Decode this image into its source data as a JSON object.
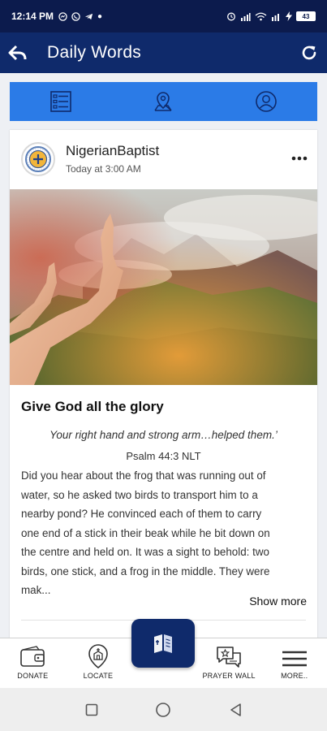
{
  "status_bar": {
    "time": "12:14 PM",
    "battery": "43"
  },
  "app_bar": {
    "title": "Daily Words"
  },
  "tabs": [
    {
      "icon": "list-icon"
    },
    {
      "icon": "location-pin-icon"
    },
    {
      "icon": "user-circle-icon"
    }
  ],
  "post": {
    "author": "NigerianBaptist",
    "time": "Today at 3:00 AM",
    "title": "Give God all the glory",
    "verse": "Your right hand and strong arm…helped them.’",
    "reference": "Psalm 44:3 NLT",
    "body_lines": [
      "Did you hear about the frog that was running out of",
      "water, so he asked two birds to transport him to a",
      "nearby pond? He convinced each of them to carry",
      "one end of a stick in their beak while he bit down on",
      "the centre and held on. It was a sight to behold: two",
      "birds, one stick, and a frog in the middle. They were",
      "mak..."
    ],
    "show_more": "Show more"
  },
  "bottom_nav": {
    "donate": "DONATE",
    "locate": "LOCATE",
    "prayer_wall": "PRAYER WALL",
    "more": "MORE.."
  },
  "colors": {
    "status_bar": "#0c1b4d",
    "app_bar": "#0f2a6b",
    "tab_bar": "#2b7be7"
  }
}
